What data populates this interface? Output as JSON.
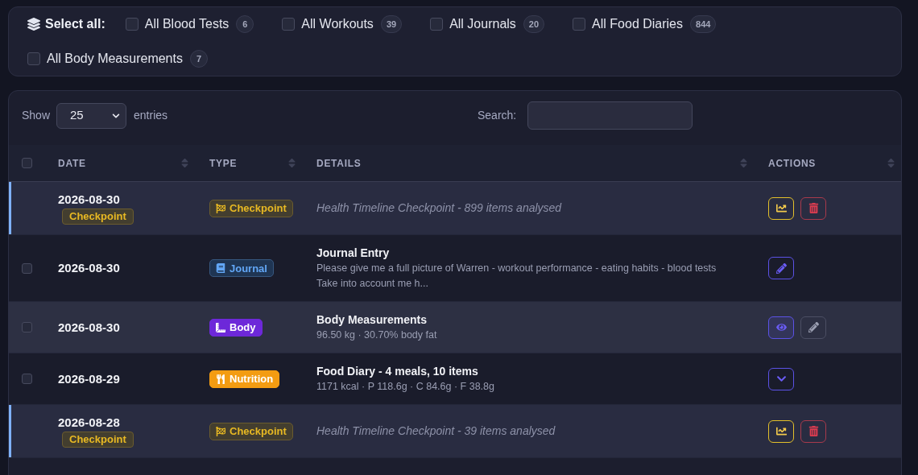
{
  "select_all": {
    "label": "Select all:",
    "options": [
      {
        "label": "All Blood Tests",
        "count": "6",
        "checked": false
      },
      {
        "label": "All Workouts",
        "count": "39",
        "checked": false
      },
      {
        "label": "All Journals",
        "count": "20",
        "checked": false
      },
      {
        "label": "All Food Diaries",
        "count": "844",
        "checked": false
      },
      {
        "label": "All Body Measurements",
        "count": "7",
        "checked": false
      }
    ]
  },
  "table_controls": {
    "show_label": "Show",
    "page_size": "25",
    "entries_label": "entries",
    "search_label": "Search:"
  },
  "table": {
    "select_all_checked": false,
    "columns": [
      {
        "label": "DATE"
      },
      {
        "label": "TYPE"
      },
      {
        "label": "DETAILS"
      },
      {
        "label": "ACTIONS"
      }
    ],
    "rows": [
      {
        "kind": "checkpoint",
        "date": "2026-08-30",
        "date_badge": "Checkpoint",
        "type": {
          "kind": "checkpoint",
          "label": "Checkpoint"
        },
        "summary": "Health Timeline Checkpoint - 899 items analysed",
        "actions": [
          {
            "kind": "chart"
          },
          {
            "kind": "delete"
          }
        ]
      },
      {
        "kind": "entry",
        "checked": false,
        "date": "2026-08-30",
        "type": {
          "kind": "journal",
          "label": "Journal"
        },
        "title": "Journal Entry",
        "summary": "Please give me a full picture of Warren - workout performance - eating habits - blood tests\nTake into account me h...",
        "actions": [
          {
            "kind": "edit"
          }
        ]
      },
      {
        "kind": "entry",
        "checked": false,
        "date": "2026-08-30",
        "type": {
          "kind": "body",
          "label": "Body"
        },
        "title": "Body Measurements",
        "summary": "96.50 kg · 30.70% body fat",
        "actions": [
          {
            "kind": "view"
          },
          {
            "kind": "edit"
          }
        ]
      },
      {
        "kind": "entry",
        "checked": false,
        "date": "2026-08-29",
        "type": {
          "kind": "nutrition",
          "label": "Nutrition"
        },
        "title": "Food Diary - 4 meals, 10 items",
        "summary": "1171 kcal · P 118.6g · C 84.6g · F 38.8g",
        "actions": [
          {
            "kind": "expand"
          }
        ]
      },
      {
        "kind": "checkpoint",
        "date": "2026-08-28",
        "date_badge": "Checkpoint",
        "type": {
          "kind": "checkpoint",
          "label": "Checkpoint"
        },
        "summary": "Health Timeline Checkpoint - 39 items analysed",
        "actions": [
          {
            "kind": "chart"
          },
          {
            "kind": "delete"
          }
        ]
      }
    ]
  }
}
